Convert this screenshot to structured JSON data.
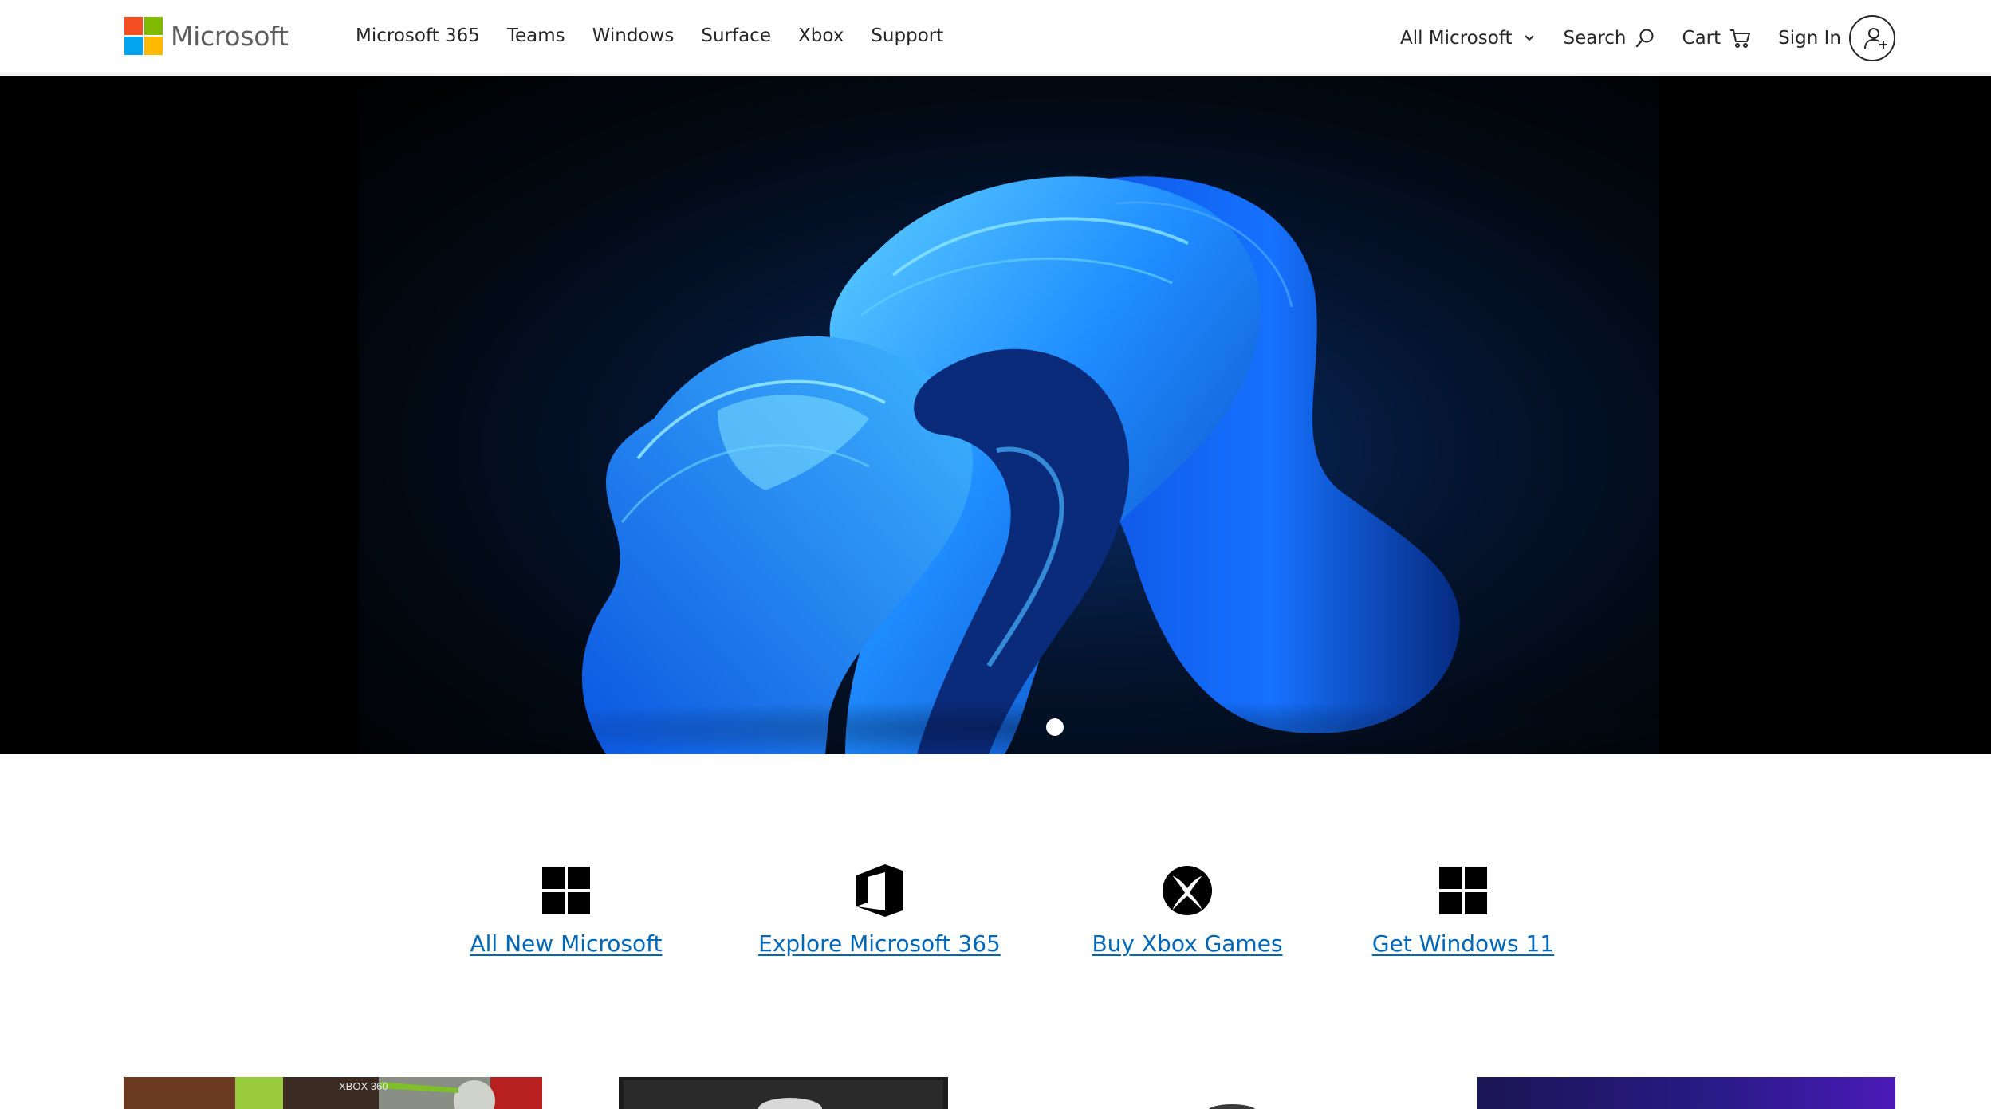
{
  "header": {
    "brand": "Microsoft",
    "logo_colors": [
      "#f25022",
      "#7fba00",
      "#00a4ef",
      "#ffb900"
    ],
    "nav": [
      "Microsoft 365",
      "Teams",
      "Windows",
      "Surface",
      "Xbox",
      "Support"
    ],
    "all_microsoft": "All Microsoft",
    "search": "Search",
    "cart": "Cart",
    "sign_in": "Sign In"
  },
  "hero": {
    "carousel_dots": 1,
    "background": "#000000",
    "accent": "#1e88ff"
  },
  "quick_links": [
    {
      "label": "All New Microsoft",
      "icon": "windows-logo-icon"
    },
    {
      "label": "Explore Microsoft 365",
      "icon": "office-logo-icon"
    },
    {
      "label": "Buy Xbox Games",
      "icon": "xbox-logo-icon"
    },
    {
      "label": "Get Windows 11",
      "icon": "windows-logo-icon"
    }
  ],
  "cards": [
    {
      "name": "xbox-360-games",
      "overlay_text": "XBOX 360"
    },
    {
      "name": "dark-product"
    },
    {
      "name": "grey-product"
    },
    {
      "name": "purple-product"
    }
  ],
  "colors": {
    "link": "#0067b8",
    "text": "#262626"
  }
}
